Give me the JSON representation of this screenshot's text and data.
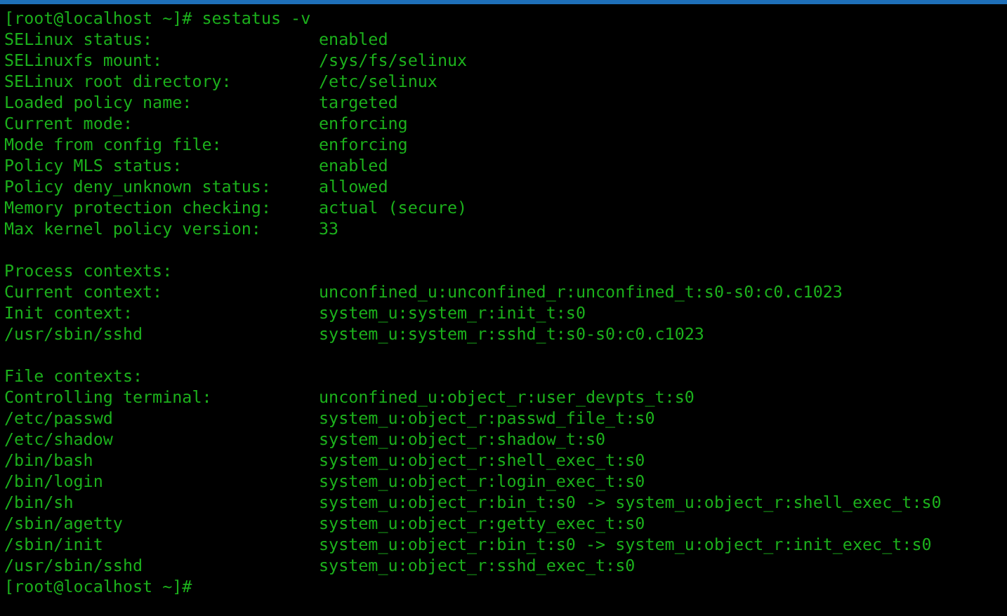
{
  "lines": [
    {
      "kind": "prompt",
      "text": "[root@localhost ~]# sestatus -v"
    },
    {
      "kind": "pair",
      "label": "SELinux status:",
      "value": "enabled"
    },
    {
      "kind": "pair",
      "label": "SELinuxfs mount:",
      "value": "/sys/fs/selinux"
    },
    {
      "kind": "pair",
      "label": "SELinux root directory:",
      "value": "/etc/selinux"
    },
    {
      "kind": "pair",
      "label": "Loaded policy name:",
      "value": "targeted"
    },
    {
      "kind": "pair",
      "label": "Current mode:",
      "value": "enforcing"
    },
    {
      "kind": "pair",
      "label": "Mode from config file:",
      "value": "enforcing"
    },
    {
      "kind": "pair",
      "label": "Policy MLS status:",
      "value": "enabled"
    },
    {
      "kind": "pair",
      "label": "Policy deny_unknown status:",
      "value": "allowed"
    },
    {
      "kind": "pair",
      "label": "Memory protection checking:",
      "value": "actual (secure)"
    },
    {
      "kind": "pair",
      "label": "Max kernel policy version:",
      "value": "33"
    },
    {
      "kind": "blank"
    },
    {
      "kind": "heading",
      "text": "Process contexts:"
    },
    {
      "kind": "pair",
      "label": "Current context:",
      "value": "unconfined_u:unconfined_r:unconfined_t:s0-s0:c0.c1023"
    },
    {
      "kind": "pair",
      "label": "Init context:",
      "value": "system_u:system_r:init_t:s0"
    },
    {
      "kind": "pair",
      "label": "/usr/sbin/sshd",
      "value": "system_u:system_r:sshd_t:s0-s0:c0.c1023"
    },
    {
      "kind": "blank"
    },
    {
      "kind": "heading",
      "text": "File contexts:"
    },
    {
      "kind": "pair",
      "label": "Controlling terminal:",
      "value": "unconfined_u:object_r:user_devpts_t:s0"
    },
    {
      "kind": "pair",
      "label": "/etc/passwd",
      "value": "system_u:object_r:passwd_file_t:s0"
    },
    {
      "kind": "pair",
      "label": "/etc/shadow",
      "value": "system_u:object_r:shadow_t:s0"
    },
    {
      "kind": "pair",
      "label": "/bin/bash",
      "value": "system_u:object_r:shell_exec_t:s0"
    },
    {
      "kind": "pair",
      "label": "/bin/login",
      "value": "system_u:object_r:login_exec_t:s0"
    },
    {
      "kind": "pair",
      "label": "/bin/sh",
      "value": "system_u:object_r:bin_t:s0 -> system_u:object_r:shell_exec_t:s0"
    },
    {
      "kind": "pair",
      "label": "/sbin/agetty",
      "value": "system_u:object_r:getty_exec_t:s0"
    },
    {
      "kind": "pair",
      "label": "/sbin/init",
      "value": "system_u:object_r:bin_t:s0 -> system_u:object_r:init_exec_t:s0"
    },
    {
      "kind": "pair",
      "label": "/usr/sbin/sshd",
      "value": "system_u:object_r:sshd_exec_t:s0"
    },
    {
      "kind": "prompt",
      "text": "[root@localhost ~]#"
    }
  ]
}
